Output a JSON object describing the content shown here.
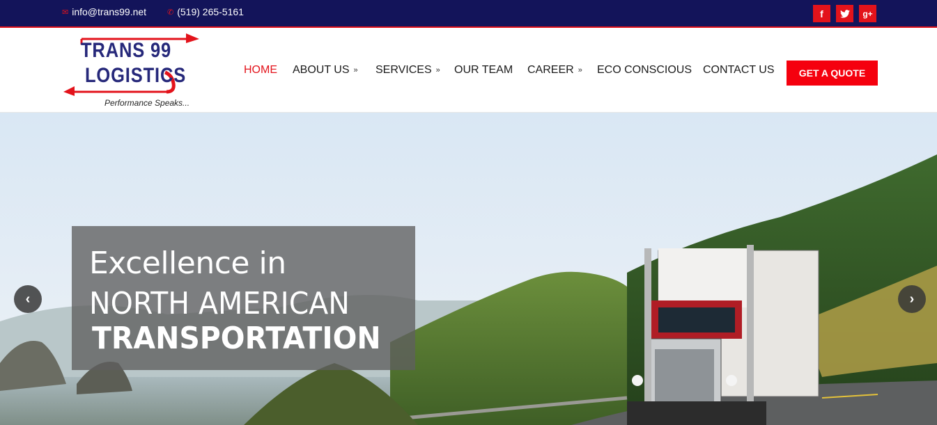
{
  "topbar": {
    "email": "info@trans99.net",
    "phone": "(519) 265-5161",
    "social": [
      {
        "name": "facebook",
        "glyph": "f"
      },
      {
        "name": "twitter",
        "glyph": "t"
      },
      {
        "name": "google-plus",
        "glyph": "g+"
      }
    ]
  },
  "logo": {
    "line1": "TRANS 99",
    "line2": "LOGISTICS",
    "tagline": "Performance Speaks..."
  },
  "nav": {
    "home": "HOME",
    "about": "ABOUT US",
    "services": "SERVICES",
    "team": "OUR TEAM",
    "career": "CAREER",
    "eco": "ECO CONSCIOUS",
    "contact": "CONTACT US",
    "quote": "GET A QUOTE",
    "active": "HOME"
  },
  "hero": {
    "line1": "Excellence in",
    "line2": "NORTH AMERICAN",
    "line3": "TRANSPORTATION"
  },
  "colors": {
    "topbar": "#13145a",
    "accent": "#e3131b",
    "logo_blue": "#26287a"
  }
}
